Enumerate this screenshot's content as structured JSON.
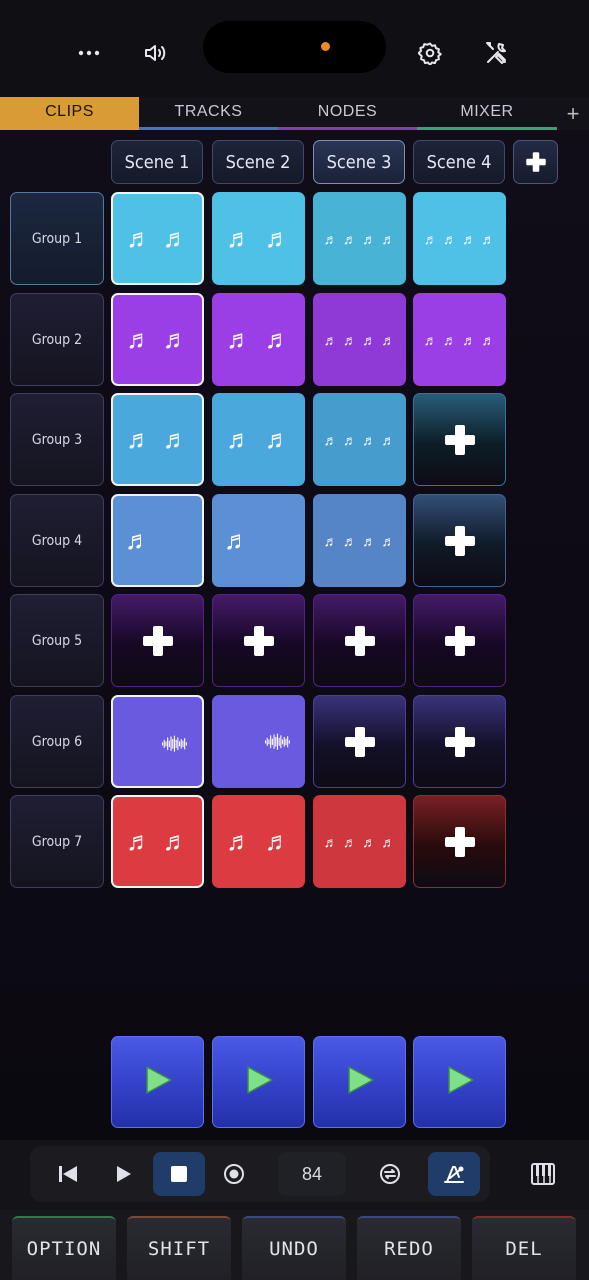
{
  "tabs": [
    {
      "label": "CLIPS",
      "color": "#d99b35"
    },
    {
      "label": "TRACKS",
      "color": "#4a73c7"
    },
    {
      "label": "NODES",
      "color": "#7a3fc2"
    },
    {
      "label": "MIXER",
      "color": "#2aa97a"
    }
  ],
  "tab_add_label": "+",
  "scenes": [
    "Scene 1",
    "Scene 2",
    "Scene 3",
    "Scene 4"
  ],
  "active_scene": 2,
  "groups": [
    "Group 1",
    "Group 2",
    "Group 3",
    "Group 4",
    "Group 5",
    "Group 6",
    "Group 7"
  ],
  "grid": [
    [
      "midi-2",
      "midi-2",
      "midi-4",
      "midi-4"
    ],
    [
      "midi-2",
      "midi-2",
      "midi-4",
      "midi-4"
    ],
    [
      "midi-2",
      "midi-2",
      "midi-4",
      "empty"
    ],
    [
      "midi-1",
      "midi-1",
      "midi-4",
      "empty"
    ],
    [
      "empty",
      "empty",
      "empty",
      "empty"
    ],
    [
      "audio",
      "audio",
      "empty",
      "empty"
    ],
    [
      "midi-2",
      "midi-2",
      "midi-4",
      "empty"
    ]
  ],
  "group_colors": [
    "#4fc0e6",
    "#9a3ee6",
    "#4aa8dc",
    "#5b8fd6",
    "#7b2fc0",
    "#6a5ae0",
    "#dc3b42"
  ],
  "transport": {
    "tempo": "84",
    "icons": [
      "skip-back-icon",
      "play-icon",
      "stop-icon",
      "record-icon",
      "loop-icon",
      "metronome-icon"
    ]
  },
  "commands": [
    {
      "label": "OPTION",
      "accent": "#2e7a4a"
    },
    {
      "label": "SHIFT",
      "accent": "#7a4a35"
    },
    {
      "label": "UNDO",
      "accent": "#3a4a7a"
    },
    {
      "label": "REDO",
      "accent": "#3a4a7a"
    },
    {
      "label": "DEL",
      "accent": "#8a2a2a"
    }
  ]
}
